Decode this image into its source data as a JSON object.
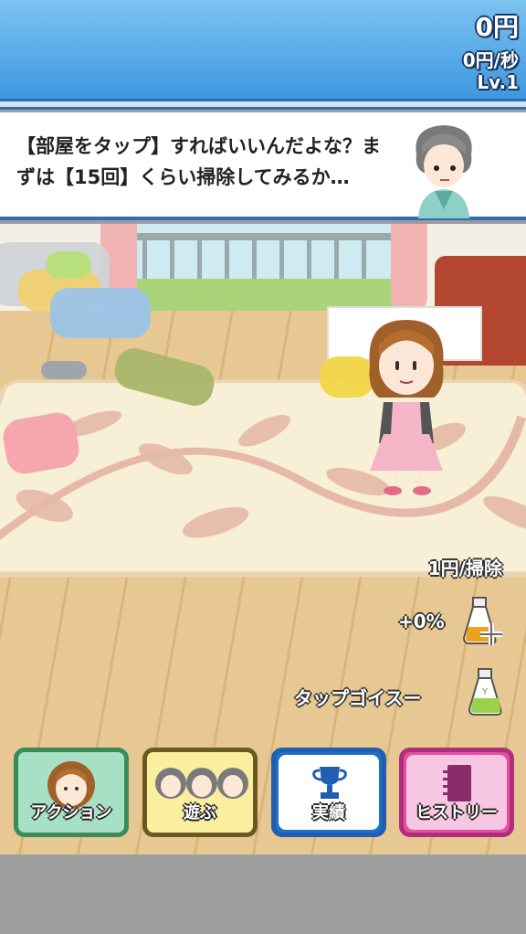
{
  "header": {
    "money": "0円",
    "rate": "0円/秒",
    "level": "Lv.1"
  },
  "dialog": {
    "text": "【部屋をタップ】すればいいんだよな？まずは【15回】くらい掃除してみるか…"
  },
  "room": {
    "per_clean": "1円/掃除",
    "bonus": "+0%",
    "tap_label": "タップゴイスー"
  },
  "nav": {
    "action": "アクション",
    "play": "遊ぶ",
    "achievements": "実績",
    "history": "ヒストリー"
  },
  "colors": {
    "header": "#3e97de",
    "action_btn": "#a8e0c5",
    "play_btn": "#f9ef9f",
    "achievements_btn": "#1f6fc9",
    "history_btn": "#e54fa3"
  }
}
